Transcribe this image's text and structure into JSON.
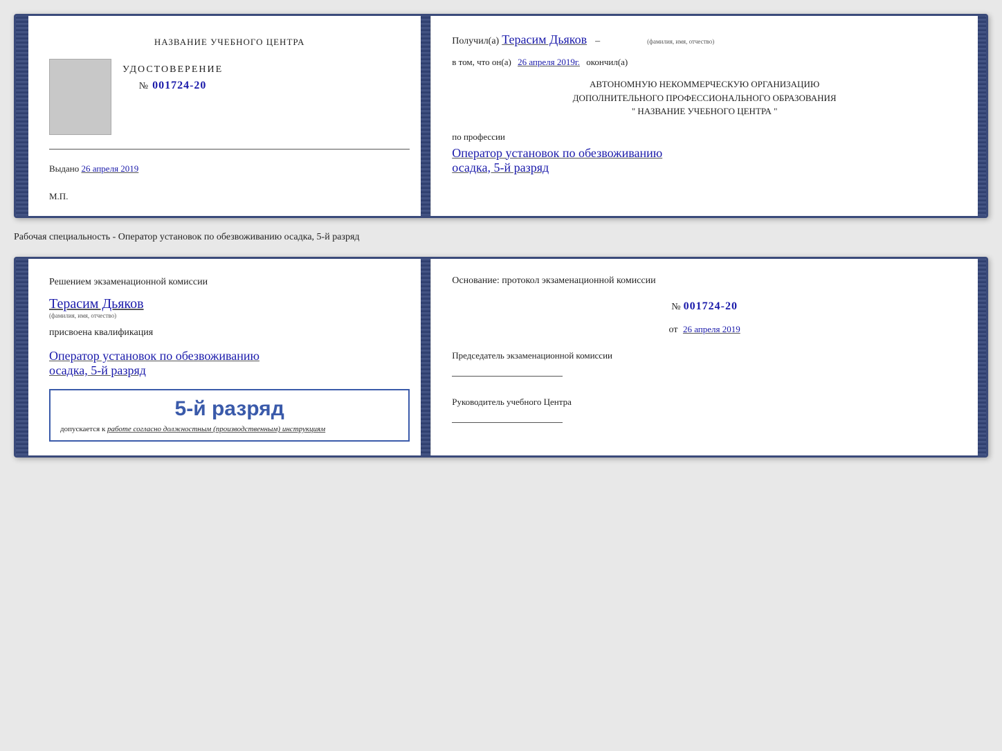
{
  "doc1": {
    "left": {
      "title": "НАЗВАНИЕ УЧЕБНОГО ЦЕНТРА",
      "cert_title": "УДОСТОВЕРЕНИЕ",
      "cert_number_prefix": "№",
      "cert_number": "001724-20",
      "issued_label": "Выдано",
      "issued_date": "26 апреля 2019",
      "mp_label": "М.П."
    },
    "right": {
      "received_prefix": "Получил(а)",
      "recipient_name": "Терасим Дьяков",
      "recipient_sublabel": "(фамилия, имя, отчество)",
      "dash": "–",
      "confirmed_prefix": "в том, что он(а)",
      "confirmed_date": "26 апреля 2019г.",
      "confirmed_suffix": "окончил(а)",
      "org_line1": "АВТОНОМНУЮ НЕКОММЕРЧЕСКУЮ ОРГАНИЗАЦИЮ",
      "org_line2": "ДОПОЛНИТЕЛЬНОГО ПРОФЕССИОНАЛЬНОГО ОБРАЗОВАНИЯ",
      "org_line3": "\" НАЗВАНИЕ УЧЕБНОГО ЦЕНТРА \"",
      "profession_label": "по профессии",
      "profession_value": "Оператор установок по обезвоживанию",
      "rank_value": "осадка, 5-й разряд"
    }
  },
  "description": "Рабочая специальность - Оператор установок по обезвоживанию осадка, 5-й разряд",
  "doc2": {
    "left": {
      "title": "Решением экзаменационной комиссии",
      "recipient_name": "Терасим Дьяков",
      "recipient_sublabel": "(фамилия, имя, отчество)",
      "qualification_label": "присвоена квалификация",
      "qualification_value": "Оператор установок по обезвоживанию",
      "rank_value": "осадка, 5-й разряд",
      "stamp_rank": "5-й разряд",
      "stamp_allowed": "допускается к",
      "stamp_allowed_italic": "работе согласно должностным (производственным) инструкциям"
    },
    "right": {
      "basis_label": "Основание: протокол экзаменационной комиссии",
      "protocol_prefix": "№",
      "protocol_number": "001724-20",
      "date_prefix": "от",
      "date_value": "26 апреля 2019",
      "chairman_title": "Председатель экзаменационной комиссии",
      "director_title": "Руководитель учебного Центра"
    }
  }
}
